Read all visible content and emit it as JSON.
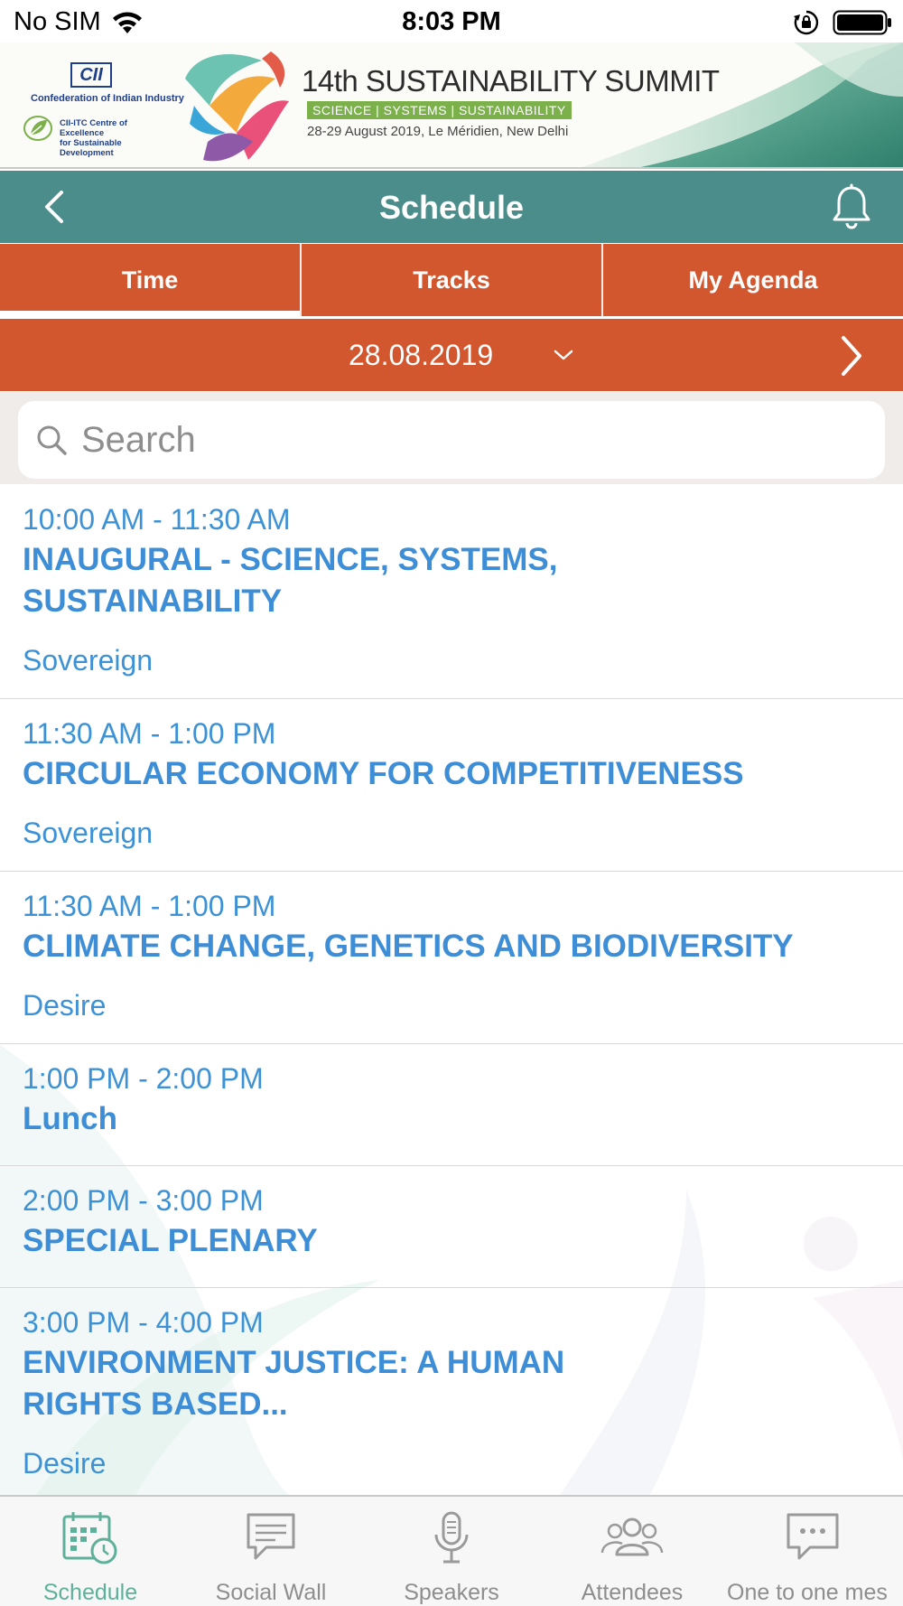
{
  "status_bar": {
    "carrier": "No SIM",
    "time": "8:03 PM",
    "icons": [
      "wifi-icon",
      "orientation-lock-icon",
      "battery-icon"
    ]
  },
  "banner": {
    "org_logo": "CII",
    "org_name": "Confederation of Indian Industry",
    "centre_name_line1": "CII-ITC Centre of Excellence",
    "centre_name_line2": "for Sustainable Development",
    "event_title": "14th SUSTAINABILITY SUMMIT",
    "event_tags": "SCIENCE | SYSTEMS | SUSTAINABILITY",
    "event_date_venue": "28-29 August 2019, Le Méridien, New Delhi"
  },
  "header": {
    "title": "Schedule",
    "back_icon": "chevron-left-icon",
    "notification_icon": "bell-icon",
    "color": "#4b8d8b"
  },
  "tabs": [
    {
      "label": "Time",
      "active": true
    },
    {
      "label": "Tracks",
      "active": false
    },
    {
      "label": "My Agenda",
      "active": false
    }
  ],
  "date_selector": {
    "selected_date": "28.08.2019",
    "accent": "#d2572f"
  },
  "search": {
    "placeholder": "Search",
    "value": ""
  },
  "sessions": [
    {
      "time": "10:00 AM - 11:30 AM",
      "title_line1": "INAUGURAL - SCIENCE, SYSTEMS,",
      "title_line2": "SUSTAINABILITY",
      "location": "Sovereign"
    },
    {
      "time": "11:30 AM - 1:00 PM",
      "title_line1": "CIRCULAR ECONOMY FOR COMPETITIVENESS",
      "title_line2": "",
      "location": "Sovereign"
    },
    {
      "time": "11:30 AM - 1:00 PM",
      "title_line1": "CLIMATE CHANGE, GENETICS AND BIODIVERSITY",
      "title_line2": "",
      "location": "Desire"
    },
    {
      "time": "1:00 PM - 2:00 PM",
      "title_line1": "Lunch",
      "title_line2": "",
      "location": ""
    },
    {
      "time": "2:00 PM - 3:00 PM",
      "title_line1": "SPECIAL PLENARY",
      "title_line2": "",
      "location": ""
    },
    {
      "time": "3:00 PM - 4:00 PM",
      "title_line1": "ENVIRONMENT JUSTICE: A HUMAN",
      "title_line2": "RIGHTS BASED...",
      "location": "Desire"
    }
  ],
  "bottom_nav": [
    {
      "label": "Schedule",
      "icon": "calendar-clock-icon",
      "active": true
    },
    {
      "label": "Social Wall",
      "icon": "chat-bubble-icon",
      "active": false
    },
    {
      "label": "Speakers",
      "icon": "microphone-icon",
      "active": false
    },
    {
      "label": "Attendees",
      "icon": "people-icon",
      "active": false
    },
    {
      "label": "One to one mes",
      "icon": "message-bubbles-icon",
      "active": false
    }
  ],
  "colors": {
    "session_text": "#3d8ed6",
    "active_nav": "#5fb09a",
    "inactive_nav": "#8e8e8e"
  }
}
